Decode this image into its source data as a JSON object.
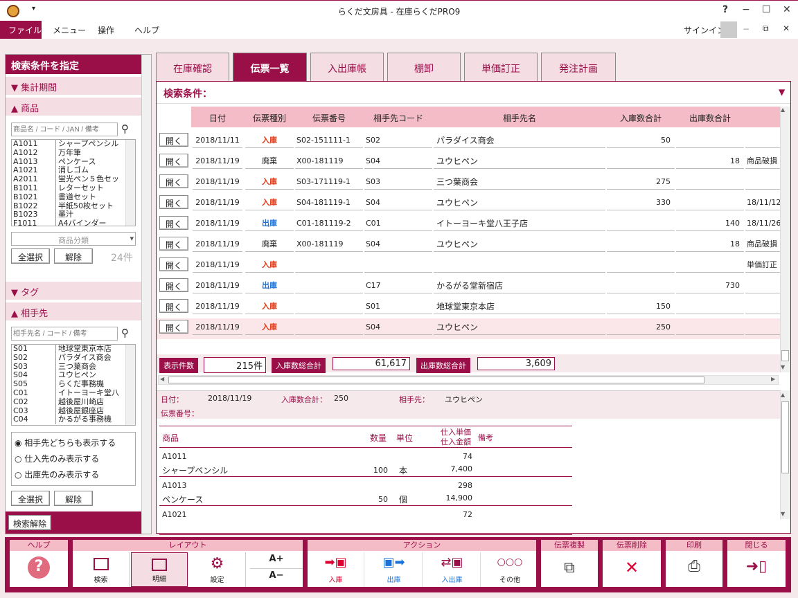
{
  "window": {
    "title": "らくだ文房具 - 在庫らくだPRO9",
    "min": "−",
    "max": "☐",
    "close": "✕",
    "help": "?"
  },
  "menu": {
    "file": "ファイル",
    "items": [
      "メニュー",
      "操作",
      "ヘルプ"
    ],
    "signin": "サインイン"
  },
  "sidebar": {
    "title": "検索条件を指定",
    "period": "集計期間",
    "product": "商品",
    "product_placeholder": "商品名 / コード / JAN / 備考",
    "products": [
      [
        "A1011",
        "シャープペンシル"
      ],
      [
        "A1012",
        "万年筆"
      ],
      [
        "A1013",
        "ペンケース"
      ],
      [
        "A1021",
        "消しゴム"
      ],
      [
        "A2011",
        "蛍光ペン５色セッ"
      ],
      [
        "B1011",
        "レターセット"
      ],
      [
        "B1021",
        "書道セット"
      ],
      [
        "B1022",
        "半紙50枚セット"
      ],
      [
        "B1023",
        "墨汁"
      ],
      [
        "F1011",
        "A4バインダー"
      ]
    ],
    "category_placeholder": "商品分類",
    "select_all": "全選択",
    "clear": "解除",
    "count": "24件",
    "tag": "タグ",
    "partner": "相手先",
    "partner_placeholder": "相手先名 / コード / 備考",
    "partners": [
      [
        "S01",
        "地球堂東京本店"
      ],
      [
        "S02",
        "パラダイス商会"
      ],
      [
        "S03",
        "三つ葉商会"
      ],
      [
        "S04",
        "ユウヒペン"
      ],
      [
        "S05",
        "らくだ事務機"
      ],
      [
        "C01",
        "イトーヨーキ堂八"
      ],
      [
        "C02",
        "越後屋川崎店"
      ],
      [
        "C03",
        "越後屋銀座店"
      ],
      [
        "C04",
        "かるがる事務機"
      ]
    ],
    "radios": [
      "相手先どちらも表示する",
      "仕入先のみ表示する",
      "出庫先のみ表示する"
    ],
    "select_all2": "全選択",
    "clear2": "解除",
    "search_clear": "検索解除"
  },
  "tabs": [
    "在庫確認",
    "伝票一覧",
    "入出庫帳",
    "棚卸",
    "単価訂正",
    "発注計画"
  ],
  "search_condition": "検索条件：",
  "grid": {
    "headers": [
      "日付",
      "伝票種別",
      "伝票番号",
      "相手先コード",
      "相手先名",
      "入庫数合計",
      "出庫数合計",
      ""
    ],
    "open_label": "開く",
    "rows": [
      {
        "date": "2018/11/11",
        "type": "入庫",
        "kind": "in",
        "no": "S02-151111-1",
        "code": "S02",
        "name": "パラダイス商会",
        "in": "50",
        "out": "",
        "note": ""
      },
      {
        "date": "2018/11/19",
        "type": "廃棄",
        "kind": "",
        "no": "X00-181119",
        "code": "S04",
        "name": "ユウヒペン",
        "in": "",
        "out": "18",
        "note": "商品破損"
      },
      {
        "date": "2018/11/19",
        "type": "入庫",
        "kind": "in",
        "no": "S03-171119-1",
        "code": "S03",
        "name": "三つ葉商会",
        "in": "275",
        "out": "",
        "note": ""
      },
      {
        "date": "2018/11/19",
        "type": "入庫",
        "kind": "in",
        "no": "S04-181119-1",
        "code": "S04",
        "name": "ユウヒペン",
        "in": "330",
        "out": "",
        "note": "18/11/12"
      },
      {
        "date": "2018/11/19",
        "type": "出庫",
        "kind": "out",
        "no": "C01-181119-2",
        "code": "C01",
        "name": "イトーヨーキ堂八王子店",
        "in": "",
        "out": "140",
        "note": "18/11/26"
      },
      {
        "date": "2018/11/19",
        "type": "廃棄",
        "kind": "",
        "no": "X00-181119",
        "code": "S04",
        "name": "ユウヒペン",
        "in": "",
        "out": "18",
        "note": "商品破損"
      },
      {
        "date": "2018/11/19",
        "type": "入庫",
        "kind": "in",
        "no": "",
        "code": "",
        "name": "",
        "in": "",
        "out": "",
        "note": "単価訂正"
      },
      {
        "date": "2018/11/19",
        "type": "出庫",
        "kind": "out",
        "no": "",
        "code": "C17",
        "name": "かるがる堂新宿店",
        "in": "",
        "out": "730",
        "note": ""
      },
      {
        "date": "2018/11/19",
        "type": "入庫",
        "kind": "in",
        "no": "",
        "code": "S01",
        "name": "地球堂東京本店",
        "in": "150",
        "out": "",
        "note": ""
      },
      {
        "date": "2018/11/19",
        "type": "入庫",
        "kind": "in",
        "no": "",
        "code": "S04",
        "name": "ユウヒペン",
        "in": "250",
        "out": "",
        "note": ""
      }
    ]
  },
  "totals": {
    "count_label": "表示件数",
    "count": "215件",
    "in_label": "入庫数総合計",
    "in": "61,617",
    "out_label": "出庫数総合計",
    "out": "3,609"
  },
  "detail": {
    "date_label": "日付：",
    "date": "2018/11/19",
    "in_label": "入庫数合計：",
    "in": "250",
    "partner_label": "相手先：",
    "partner": "ユウヒペン",
    "slip_label": "伝票番号：",
    "headers": {
      "product": "商品",
      "qty": "数量",
      "unit": "単位",
      "price1": "仕入単価",
      "price2": "仕入金額",
      "note": "備考"
    },
    "lines": [
      {
        "code": "A1011",
        "name": "シャープペンシル",
        "qty": "100",
        "unit": "本",
        "price": "74",
        "amount": "7,400"
      },
      {
        "code": "A1013",
        "name": "ペンケース",
        "qty": "50",
        "unit": "個",
        "price": "298",
        "amount": "14,900"
      },
      {
        "code": "A1021",
        "name": "",
        "qty": "",
        "unit": "",
        "price": "72",
        "amount": ""
      }
    ]
  },
  "toolbar": {
    "help": "ヘルプ",
    "layout": "レイアウト",
    "action": "アクション",
    "copy": "伝票複製",
    "delete": "伝票削除",
    "print": "印刷",
    "close": "閉じる",
    "search": "検索",
    "detail": "明細",
    "settings": "設定",
    "font_up": "A+",
    "font_down": "A−",
    "in": "入庫",
    "out": "出庫",
    "inout": "入出庫",
    "other": "その他"
  }
}
